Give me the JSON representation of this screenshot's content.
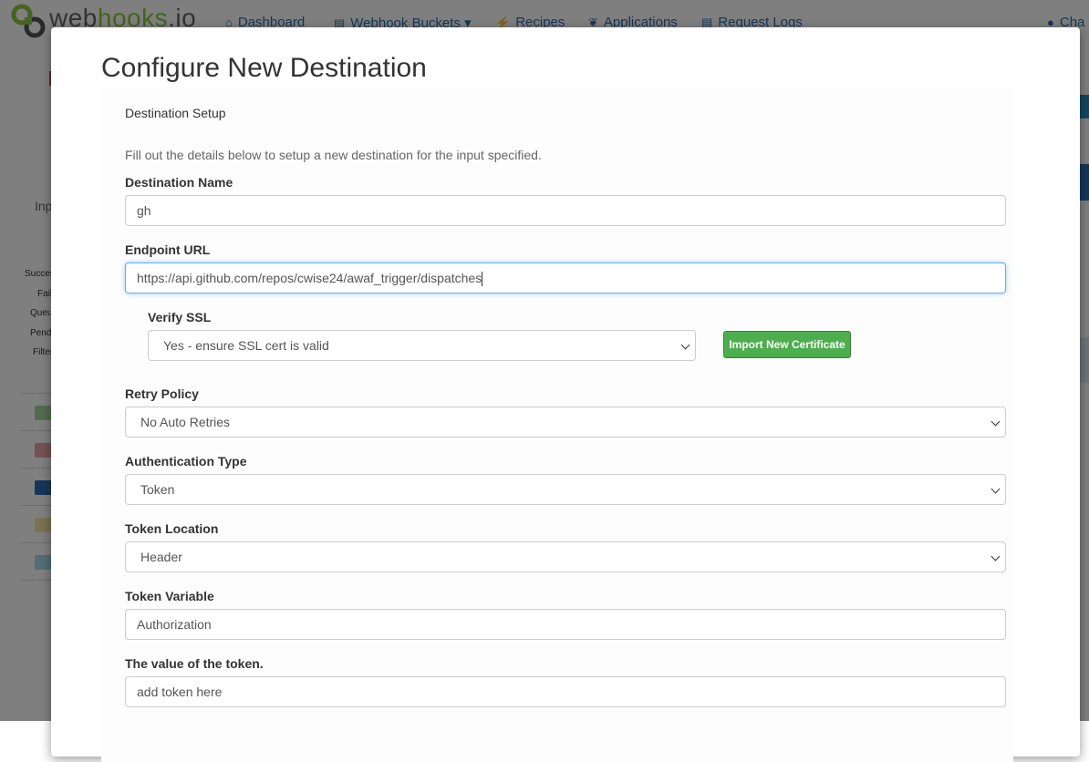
{
  "background": {
    "brand": {
      "prefix": "web",
      "highlight": "hooks",
      "suffix": ".io"
    },
    "nav": [
      {
        "icon": "home-icon",
        "glyph": "⌂",
        "label": "Dashboard"
      },
      {
        "icon": "list-icon",
        "glyph": "▤",
        "label": "Webhook Buckets ▾"
      },
      {
        "icon": "bolt-icon",
        "glyph": "⚡",
        "label": "Recipes"
      },
      {
        "icon": "leaf-icon",
        "glyph": "❦",
        "label": "Applications"
      },
      {
        "icon": "doc-icon",
        "glyph": "▤",
        "label": "Request Logs"
      }
    ],
    "user_label": "Cha",
    "side_texts": [
      "Inp",
      "Succes",
      "Fail",
      "Queu",
      "Pendi",
      "Filter"
    ]
  },
  "modal": {
    "title": "Configure New Destination",
    "panel_heading": "Destination Setup",
    "intro": "Fill out the details below to setup a new destination for the input specified.",
    "destination_name": {
      "label": "Destination Name",
      "value": "gh"
    },
    "endpoint_url": {
      "label": "Endpoint URL",
      "value": "https://api.github.com/repos/cwise24/awaf_trigger/dispatches"
    },
    "verify_ssl": {
      "label": "Verify SSL",
      "selected": "Yes - ensure SSL cert is valid",
      "import_button": "Import New Certificate"
    },
    "retry_policy": {
      "label": "Retry Policy",
      "selected": "No Auto Retries"
    },
    "auth_type": {
      "label": "Authentication Type",
      "selected": "Token"
    },
    "token_location": {
      "label": "Token Location",
      "selected": "Header"
    },
    "token_variable": {
      "label": "Token Variable",
      "value": "Authorization"
    },
    "token_value": {
      "label": "The value of the token.",
      "placeholder": "add token here"
    }
  },
  "colors": {
    "accent_green": "#4cae4c",
    "link_blue": "#2a6fb0",
    "focus_blue": "#66afe9"
  }
}
